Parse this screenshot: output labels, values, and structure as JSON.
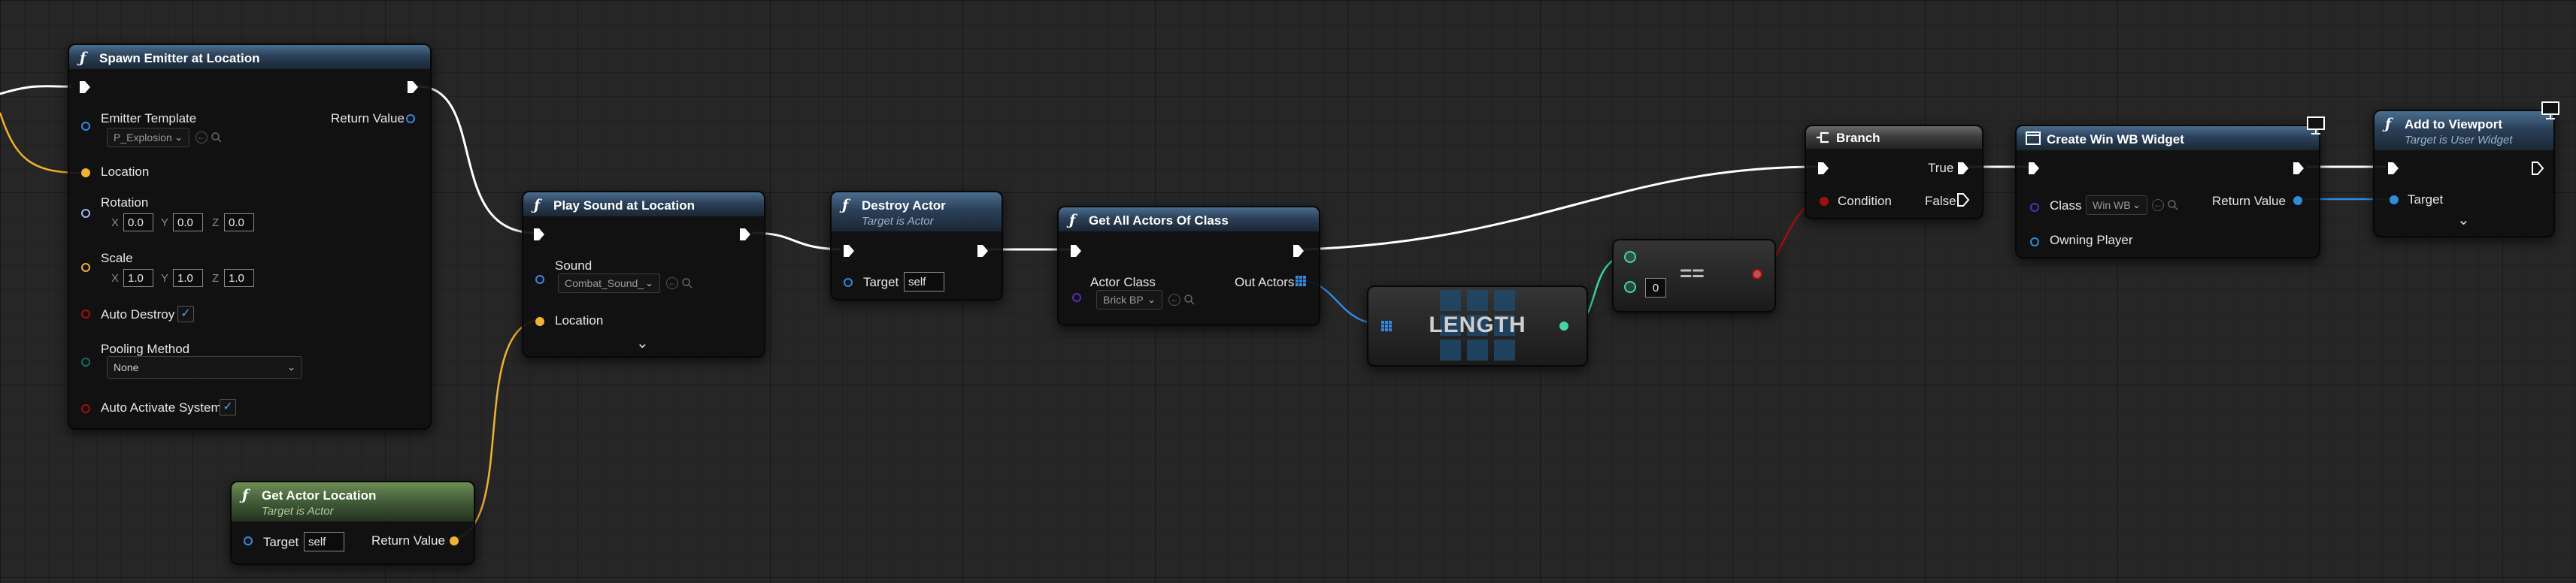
{
  "nodes": {
    "spawn_emitter": {
      "title": "Spawn Emitter at Location",
      "emitter_template_label": "Emitter Template",
      "emitter_template_value": "P_Explosion",
      "return_value_label": "Return Value",
      "location_label": "Location",
      "rotation_label": "Rotation",
      "rotation": {
        "x": "0.0",
        "y": "0.0",
        "z": "0.0"
      },
      "scale_label": "Scale",
      "scale": {
        "x": "1.0",
        "y": "1.0",
        "z": "1.0"
      },
      "auto_destroy_label": "Auto Destroy",
      "auto_destroy_checked": true,
      "pooling_method_label": "Pooling Method",
      "pooling_method_value": "None",
      "auto_activate_label": "Auto Activate System",
      "auto_activate_checked": true,
      "axis_x": "X",
      "axis_y": "Y",
      "axis_z": "Z"
    },
    "play_sound": {
      "title": "Play Sound at Location",
      "sound_label": "Sound",
      "sound_value": "Combat_Sound_",
      "location_label": "Location"
    },
    "destroy_actor": {
      "title": "Destroy Actor",
      "subtitle": "Target is Actor",
      "target_label": "Target",
      "target_value": "self"
    },
    "get_all_actors": {
      "title": "Get All Actors Of Class",
      "actor_class_label": "Actor Class",
      "actor_class_value": "Brick BP",
      "out_actors_label": "Out Actors"
    },
    "length": {
      "title": "LENGTH"
    },
    "equals": {
      "symbol": "==",
      "input_value": "0"
    },
    "branch": {
      "title": "Branch",
      "condition_label": "Condition",
      "true_label": "True",
      "false_label": "False"
    },
    "create_widget": {
      "title": "Create Win WB Widget",
      "class_label": "Class",
      "class_value": "Win WB",
      "return_value_label": "Return Value",
      "owning_player_label": "Owning Player"
    },
    "add_to_viewport": {
      "title": "Add to Viewport",
      "subtitle": "Target is User Widget",
      "target_label": "Target"
    },
    "get_actor_location": {
      "title": "Get Actor Location",
      "subtitle": "Target is Actor",
      "target_label": "Target",
      "target_value": "self",
      "return_value_label": "Return Value"
    }
  },
  "colors": {
    "exec": "#ffffff",
    "object": "#2f8ae0",
    "vector": "#f0b429",
    "rotator": "#9db9f5",
    "boolean": "#a01010",
    "integer": "#3cd9a7",
    "enum": "#0a6e5e",
    "class": "#5d2bb8",
    "call_header": "#2b4159",
    "pure_header": "#45603a"
  },
  "icons": [
    "function-icon",
    "exec-pin-icon",
    "branch-icon",
    "widget-icon",
    "monitor-icon",
    "dropdown-icon",
    "browse-icon",
    "search-icon",
    "checkmark-icon",
    "expand-arrow-icon",
    "array-pin-icon"
  ]
}
